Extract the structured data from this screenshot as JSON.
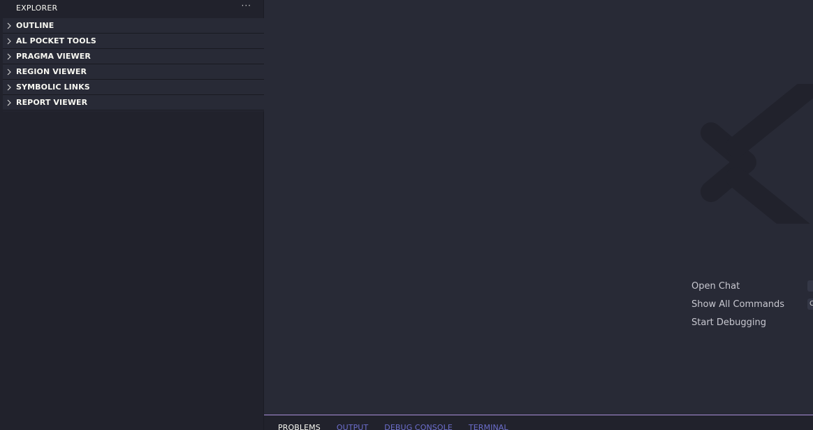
{
  "sidebar": {
    "title": "EXPLORER",
    "more_label": "···",
    "sections": [
      {
        "label": "OUTLINE"
      },
      {
        "label": "AL POCKET TOOLS"
      },
      {
        "label": "PRAGMA VIEWER"
      },
      {
        "label": "REGION VIEWER"
      },
      {
        "label": "SYMBOLIC LINKS"
      },
      {
        "label": "REPORT VIEWER"
      }
    ]
  },
  "editor": {
    "watermark_icon": "vscode-logo-icon",
    "shortcuts": [
      {
        "label": "Open Chat",
        "key": ""
      },
      {
        "label": "Show All Commands",
        "key": "Ct"
      },
      {
        "label": "Start Debugging",
        "key": ""
      }
    ]
  },
  "panel": {
    "tabs": [
      {
        "label": "PROBLEMS",
        "active": true
      },
      {
        "label": "OUTPUT",
        "active": false
      },
      {
        "label": "DEBUG CONSOLE",
        "active": false
      },
      {
        "label": "TERMINAL",
        "active": false
      }
    ]
  },
  "colors": {
    "sidebar_bg": "#21222c",
    "editor_bg": "#282a36",
    "accent": "#a98fd8",
    "inactive_tab": "#6c6ecc"
  }
}
